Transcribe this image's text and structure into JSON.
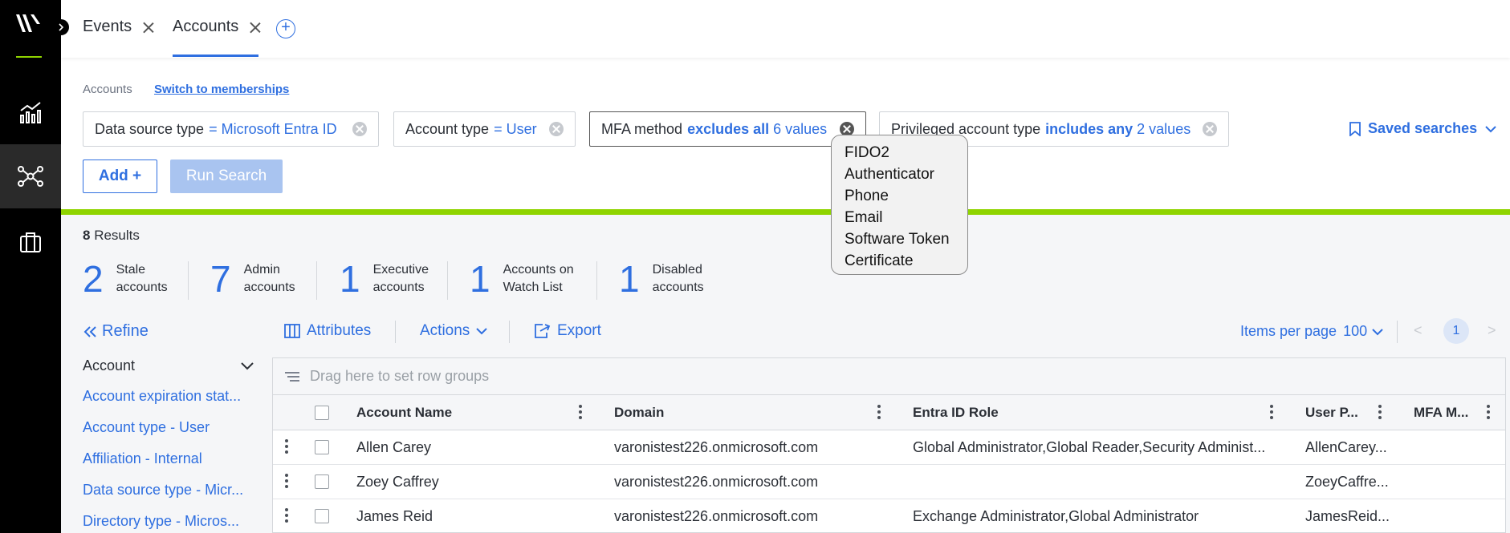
{
  "tabs": [
    {
      "label": "Events"
    },
    {
      "label": "Accounts"
    }
  ],
  "breadcrumb": {
    "current": "Accounts",
    "switch_link": "Switch to memberships"
  },
  "filters": [
    {
      "key": "Data source type",
      "op": "=",
      "value": "Microsoft Entra ID"
    },
    {
      "key": "Account type",
      "op": "=",
      "value": "User"
    },
    {
      "key": "MFA method",
      "op": "excludes all",
      "value": "6 values"
    },
    {
      "key": "Privileged account type",
      "op": "includes any",
      "value": "2 values"
    }
  ],
  "saved_searches": "Saved searches",
  "buttons": {
    "add": "Add +",
    "run": "Run Search"
  },
  "popover": {
    "items": [
      "FIDO2",
      "Authenticator",
      "Phone",
      "Email",
      "Software Token",
      "Certificate"
    ]
  },
  "results": {
    "count": "8",
    "label": "Results"
  },
  "stats": [
    {
      "n": "2",
      "l1": "Stale",
      "l2": "accounts"
    },
    {
      "n": "7",
      "l1": "Admin",
      "l2": "accounts"
    },
    {
      "n": "1",
      "l1": "Executive",
      "l2": "accounts"
    },
    {
      "n": "1",
      "l1": "Accounts on",
      "l2": "Watch List"
    },
    {
      "n": "1",
      "l1": "Disabled",
      "l2": "accounts"
    }
  ],
  "refine": "Refine",
  "facets": {
    "header": "Account",
    "items": [
      "Account expiration stat...",
      "Account type - User",
      "Affiliation - Internal",
      "Data source type - Micr...",
      "Directory type - Micros..."
    ]
  },
  "toolbar": {
    "attributes": "Attributes",
    "actions": "Actions",
    "export": "Export",
    "items_per_page": "Items per page",
    "ipp_value": "100",
    "page": "1",
    "prev": "<",
    "next": ">"
  },
  "grid": {
    "group_placeholder": "Drag here to set row groups",
    "columns": [
      "Account Name",
      "Domain",
      "Entra ID Role",
      "User P...",
      "MFA M..."
    ],
    "rows": [
      [
        "Allen Carey",
        "varonistest226.onmicrosoft.com",
        "Global Administrator,Global Reader,Security Administ...",
        "AllenCarey..."
      ],
      [
        "Zoey Caffrey",
        "varonistest226.onmicrosoft.com",
        "",
        "ZoeyCaffre..."
      ],
      [
        "James Reid",
        "varonistest226.onmicrosoft.com",
        "Exchange Administrator,Global Administrator",
        "JamesReid..."
      ]
    ]
  },
  "colors": {
    "accent": "#2f6fe0",
    "green": "#8fd400",
    "rail": "#000000"
  }
}
